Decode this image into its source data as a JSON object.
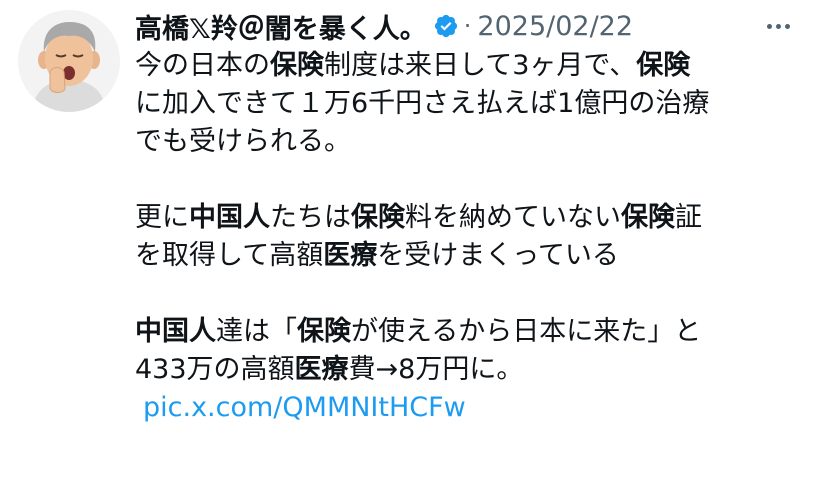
{
  "tweet": {
    "author_name": "高橋𝕏羚＠闇を暴く人。",
    "separator": "·",
    "date": "2025/02/22",
    "lines": [
      [
        {
          "t": "今の日本の"
        },
        {
          "t": "保険",
          "b": true
        },
        {
          "t": "制度は来日して3ヶ月で、"
        },
        {
          "t": "保険",
          "b": true
        }
      ],
      [
        {
          "t": "に加入できて１万6千円さえ払えば1億円の治療"
        }
      ],
      [
        {
          "t": "でも受けられる。"
        }
      ],
      [],
      [
        {
          "t": "更に"
        },
        {
          "t": "中国人",
          "b": true
        },
        {
          "t": "たちは"
        },
        {
          "t": "保険",
          "b": true
        },
        {
          "t": "料を納めていない"
        },
        {
          "t": "保険",
          "b": true
        },
        {
          "t": "証"
        }
      ],
      [
        {
          "t": "を取得して高額"
        },
        {
          "t": "医療",
          "b": true
        },
        {
          "t": "を受けまくっている"
        }
      ],
      [],
      [
        {
          "t": "中国人",
          "b": true
        },
        {
          "t": "達は「"
        },
        {
          "t": "保険",
          "b": true
        },
        {
          "t": "が使えるから日本に来た」と"
        }
      ],
      [
        {
          "t": "433万の高額"
        },
        {
          "t": "医療",
          "b": true
        },
        {
          "t": "費→8万円に。"
        }
      ]
    ],
    "link": "pic.x.com/QMMNItHCFw"
  },
  "icons": {
    "avatar": "memoji-avatar-yawning",
    "verified": "verified-badge-icon",
    "more": "more-options-icon"
  },
  "colors": {
    "text": "#0f1419",
    "secondary": "#536471",
    "link": "#1d9bf0",
    "verified": "#1d9bf0"
  }
}
